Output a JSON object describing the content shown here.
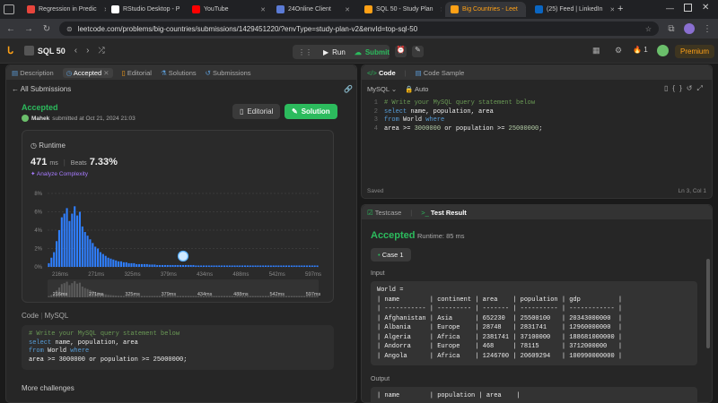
{
  "browser": {
    "tabs": [
      {
        "label": "Regression in Predic",
        "color": "#e8453c"
      },
      {
        "label": "RStudio Desktop - P",
        "color": "#ffffff"
      },
      {
        "label": "YouTube",
        "color": "#ff0000"
      },
      {
        "label": "24Online Client",
        "color": "#5b7bd5"
      },
      {
        "label": "SQL 50 - Study Plan",
        "color": "#ffa116"
      },
      {
        "label": "Big Countries - Leet",
        "color": "#ffa116"
      },
      {
        "label": "(25) Feed | LinkedIn",
        "color": "#0a66c2"
      }
    ],
    "url": "leetcode.com/problems/big-countries/submissions/1429451220/?envType=study-plan-v2&envId=top-sql-50"
  },
  "lc_header": {
    "study_plan": "SQL 50",
    "run": "Run",
    "submit": "Submit",
    "streak": "1",
    "premium": "Premium"
  },
  "left_tabs": [
    "Description",
    "Accepted",
    "Editorial",
    "Solutions",
    "Submissions"
  ],
  "all_submissions": "All Submissions",
  "status": "Accepted",
  "user": "Mahek",
  "submitted": "submitted at Oct 21, 2024 21:03",
  "editorial_btn": "Editorial",
  "solution_btn": "Solution",
  "runtime": {
    "label": "Runtime",
    "value": "471",
    "unit": "ms",
    "beats_label": "Beats",
    "beats": "7.33%",
    "analyze": "Analyze Complexity"
  },
  "chart_data": {
    "type": "bar",
    "title": "",
    "xlabel": "",
    "ylabel": "",
    "ylim": [
      0,
      8
    ],
    "yticks": [
      "8%",
      "6%",
      "4%",
      "2%",
      "0%"
    ],
    "xticks": [
      "216ms",
      "271ms",
      "325ms",
      "379ms",
      "434ms",
      "488ms",
      "542ms",
      "597ms"
    ],
    "mini_xticks": [
      "216ms",
      "271ms",
      "325ms",
      "379ms",
      "434ms",
      "488ms",
      "542ms",
      "597ms"
    ],
    "values": [
      0.4,
      1.0,
      1.6,
      2.8,
      4.0,
      5.4,
      5.8,
      6.4,
      5.0,
      5.8,
      6.6,
      5.6,
      6.0,
      4.4,
      3.8,
      3.4,
      3.0,
      2.6,
      2.2,
      2.0,
      1.6,
      1.4,
      1.2,
      1.0,
      0.9,
      0.8,
      0.7,
      0.6,
      0.6,
      0.5,
      0.5,
      0.4,
      0.4,
      0.4,
      0.3,
      0.3,
      0.3,
      0.3,
      0.3,
      0.25,
      0.25,
      0.25,
      0.2,
      0.2,
      0.2,
      0.2,
      0.2,
      0.2,
      0.2,
      0.2,
      0.2,
      0.2,
      0.2,
      0.2,
      0.2,
      0.2,
      0.2,
      0.15,
      0.15,
      0.15,
      0.15,
      0.15,
      0.15,
      0.15,
      0.15,
      0.15,
      0.15,
      0.15,
      0.15,
      0.15,
      0.15,
      0.15,
      0.15,
      0.15,
      0.15,
      0.15,
      0.15,
      0.15,
      0.15,
      0.15,
      0.15,
      0.15,
      0.15,
      0.15,
      0.15,
      0.15,
      0.15,
      0.15,
      0.15,
      0.15,
      0.15,
      0.15,
      0.15,
      0.15,
      0.15,
      0.15,
      0.15,
      0.15,
      0.15,
      0.15,
      0.15,
      0.15,
      0.15,
      0.15,
      0.15
    ],
    "highlight_index": 52,
    "bar_color": "#2f7fff"
  },
  "code_label": "Code",
  "code_lang": "MySQL",
  "code_lines": [
    "# Write your MySQL query statement below",
    "select name, population, area",
    "from World where",
    "area >= 3000000 or population >= 25000000;"
  ],
  "more_challenges": "More challenges",
  "editor": {
    "tabs": [
      "Code",
      "Code Sample"
    ],
    "lang": "MySQL",
    "auto": "Auto",
    "saved": "Saved",
    "pos": "Ln 3, Col 1",
    "line_numbers": [
      "1",
      "2",
      "3",
      "4"
    ]
  },
  "result": {
    "tabs": [
      "Testcase",
      "Test Result"
    ],
    "status": "Accepted",
    "runtime": "Runtime: 85 ms",
    "case": "Case 1",
    "input_label": "Input",
    "output_label": "Output",
    "input_table": "World =\n| name        | continent | area    | population | gdp          |\n| ----------- | --------- | ------- | ---------- | ------------ |\n| Afghanistan | Asia      | 652230  | 25500100   | 20343000000  |\n| Albania     | Europe    | 28748   | 2831741    | 12960000000  |\n| Algeria     | Africa    | 2381741 | 37100000   | 188681000000 |\n| Andorra     | Europe    | 468     | 78115      | 3712000000   |\n| Angola      | Africa    | 1246700 | 20609294   | 100990000000 |",
    "output_table": "| name        | population | area    |"
  }
}
